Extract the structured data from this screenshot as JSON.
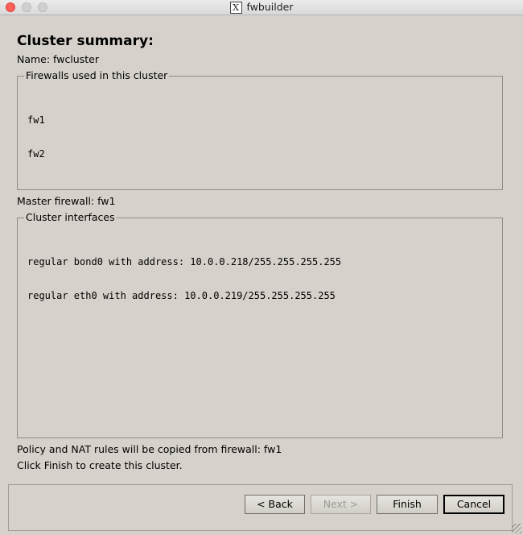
{
  "window": {
    "title": "fwbuilder"
  },
  "page": {
    "heading": "Cluster summary:",
    "name_line": "Name: fwcluster",
    "firewalls_group": {
      "title": "Firewalls used in this cluster",
      "items": [
        "fw1",
        "fw2"
      ]
    },
    "master_line": "Master firewall: fw1",
    "interfaces_group": {
      "title": "Cluster interfaces",
      "items": [
        "regular bond0 with address: 10.0.0.218/255.255.255.255",
        "regular eth0 with address: 10.0.0.219/255.255.255.255"
      ]
    },
    "policy_line": "Policy and NAT rules will be copied from firewall: fw1",
    "finish_hint": "Click Finish to create this cluster."
  },
  "buttons": {
    "back": "< Back",
    "next": "Next >",
    "finish": "Finish",
    "cancel": "Cancel"
  },
  "colors": {
    "background": "#d6d2cb",
    "close": "#fc5f57"
  }
}
